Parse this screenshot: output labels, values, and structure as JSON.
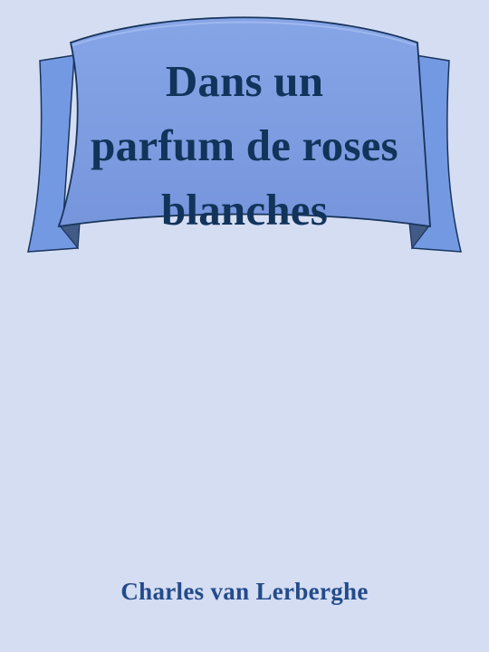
{
  "book": {
    "title_lines": [
      "Dans un",
      "parfum de roses",
      "blanches"
    ],
    "author": "Charles van Lerberghe"
  },
  "colors": {
    "background": "#d5ddf3",
    "banner_front": "#7f9fe3",
    "banner_back": "#7499e3",
    "banner_shadow": "#425a86",
    "title_text": "#12335a",
    "author_text": "#234b8a",
    "outline": "#17345b"
  },
  "icons": {
    "banner": "ribbon-banner-icon"
  }
}
